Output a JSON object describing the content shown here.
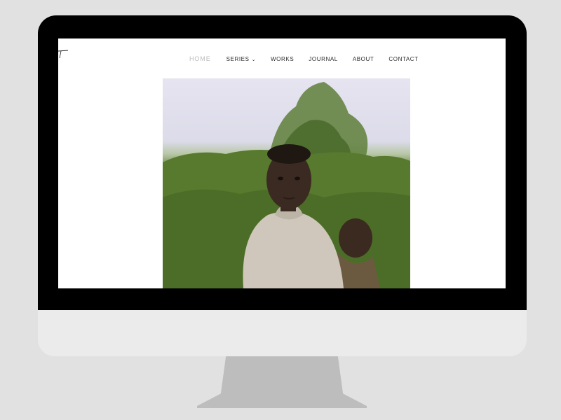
{
  "nav": {
    "home": "HOME",
    "series": "SERIES",
    "works": "WORKS",
    "journal": "JOURNAL",
    "about": "ABOUT",
    "contact": "CONTACT"
  },
  "icons": {
    "series_dropdown": "chevron-down-icon"
  },
  "colors": {
    "nav_active": "#bcbcbc",
    "nav_text": "#2b2b2b",
    "monitor_bezel": "#000000",
    "monitor_chin": "#ebebeb",
    "background": "#e1e1e1"
  }
}
